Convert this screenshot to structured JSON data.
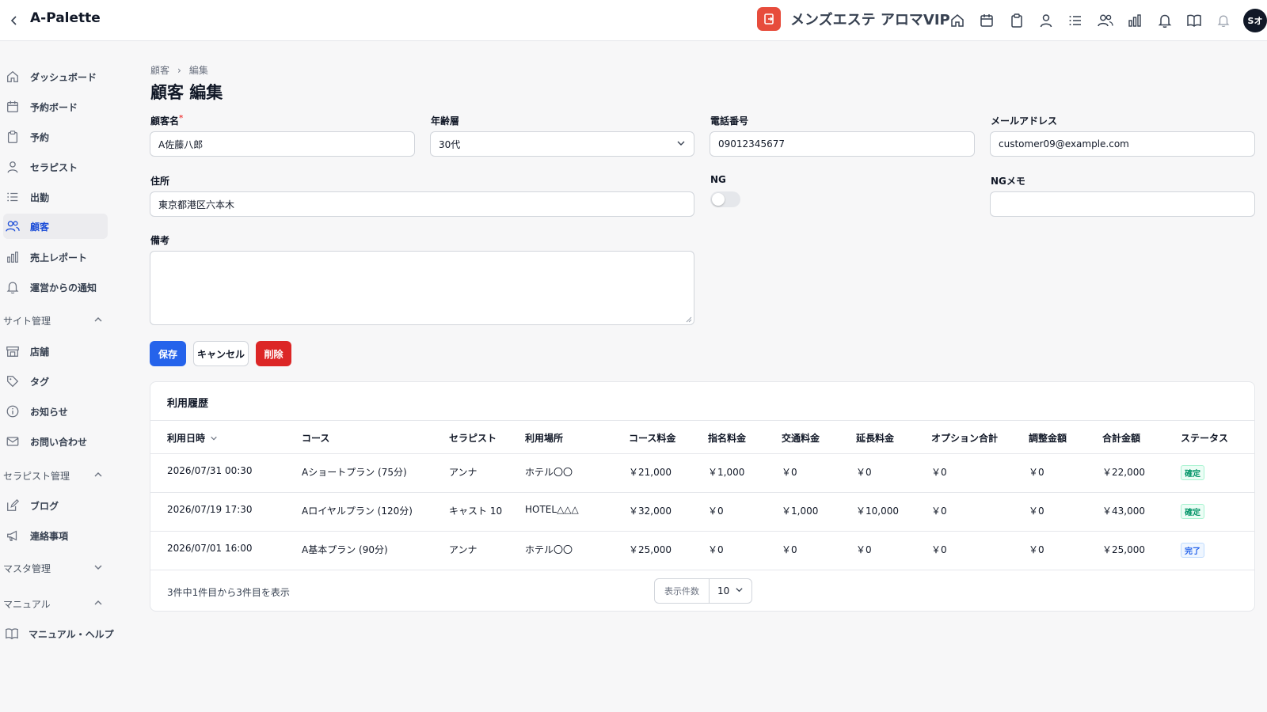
{
  "header": {
    "app_title": "A-Palette",
    "brand_name": "メンズエステ アロマVIP",
    "avatar_text": "Sオ",
    "nav_icons": [
      "home-icon",
      "calendar-icon",
      "clipboard-icon",
      "user-icon",
      "list-icon",
      "users-icon",
      "bar-chart-icon",
      "bell-icon",
      "book-icon",
      "notification-icon"
    ]
  },
  "sidebar": {
    "items": [
      {
        "label": "ダッシュボード",
        "icon": "home-icon"
      },
      {
        "label": "予約ボード",
        "icon": "calendar-icon"
      },
      {
        "label": "予約",
        "icon": "clipboard-icon"
      },
      {
        "label": "セラピスト",
        "icon": "user-icon"
      },
      {
        "label": "出勤",
        "icon": "list-icon"
      },
      {
        "label": "顧客",
        "icon": "users-icon",
        "active": true
      },
      {
        "label": "売上レポート",
        "icon": "bar-chart-icon"
      },
      {
        "label": "運営からの通知",
        "icon": "bell-icon"
      }
    ],
    "site_group": "サイト管理",
    "site_items": [
      {
        "label": "店舗",
        "icon": "store-icon"
      },
      {
        "label": "タグ",
        "icon": "tag-icon"
      },
      {
        "label": "お知らせ",
        "icon": "info-icon"
      },
      {
        "label": "お問い合わせ",
        "icon": "mail-icon"
      }
    ],
    "therapist_group": "セラピスト管理",
    "therapist_items": [
      {
        "label": "ブログ",
        "icon": "edit-icon"
      },
      {
        "label": "連絡事項",
        "icon": "megaphone-icon"
      }
    ],
    "master_group": "マスタ管理",
    "manual_group": "マニュアル",
    "manual_items": [
      {
        "label": "マニュアル・ヘルプ",
        "icon": "book-icon"
      }
    ]
  },
  "breadcrumb": {
    "parent": "顧客",
    "separator": "›",
    "current": "編集"
  },
  "page_title": "顧客 編集",
  "form": {
    "name_label": "顧客名",
    "name_required": "*",
    "name_value": "A佐藤八郎",
    "age_label": "年齢層",
    "age_value": "30代",
    "phone_label": "電話番号",
    "phone_value": "09012345677",
    "email_label": "メールアドレス",
    "email_value": "customer09@example.com",
    "address_label": "住所",
    "address_value": "東京都港区六本木",
    "ng_label": "NG",
    "ng_enabled": false,
    "ng_memo_label": "NGメモ",
    "ng_memo_value": "",
    "notes_label": "備考",
    "notes_value": ""
  },
  "buttons": {
    "save": "保存",
    "cancel": "キャンセル",
    "delete": "削除"
  },
  "history": {
    "title": "利用履歴",
    "columns": [
      "利用日時",
      "コース",
      "セラピスト",
      "利用場所",
      "コース料金",
      "指名料金",
      "交通料金",
      "延長料金",
      "オプション合計",
      "調整金額",
      "合計金額",
      "ステータス"
    ],
    "rows": [
      {
        "date": "2026/07/31 00:30",
        "course": "Aショートプラン (75分)",
        "therapist": "アンナ",
        "place": "ホテル〇〇",
        "course_fee": "￥21,000",
        "nomination_fee": "￥1,000",
        "transport_fee": "￥0",
        "extension_fee": "￥0",
        "option_total": "￥0",
        "adjustment": "￥0",
        "total": "￥22,000",
        "status": "確定"
      },
      {
        "date": "2026/07/19 17:30",
        "course": "Aロイヤルプラン (120分)",
        "therapist": "キャスト 10",
        "place": "HOTEL△△△",
        "course_fee": "￥32,000",
        "nomination_fee": "￥0",
        "transport_fee": "￥1,000",
        "extension_fee": "￥10,000",
        "option_total": "￥0",
        "adjustment": "￥0",
        "total": "￥43,000",
        "status": "確定"
      },
      {
        "date": "2026/07/01 16:00",
        "course": "A基本プラン (90分)",
        "therapist": "アンナ",
        "place": "ホテル〇〇",
        "course_fee": "￥25,000",
        "nomination_fee": "￥0",
        "transport_fee": "￥0",
        "extension_fee": "￥0",
        "option_total": "￥0",
        "adjustment": "￥0",
        "total": "￥25,000",
        "status": "完了"
      }
    ],
    "footer_text": "3件中1件目から3件目を表示",
    "page_size_label": "表示件数",
    "page_size_value": "10"
  },
  "colors": {
    "primary": "#2563eb",
    "danger": "#dc2626",
    "brand": "#e74c3c",
    "active_nav": "#1d4ed8"
  }
}
